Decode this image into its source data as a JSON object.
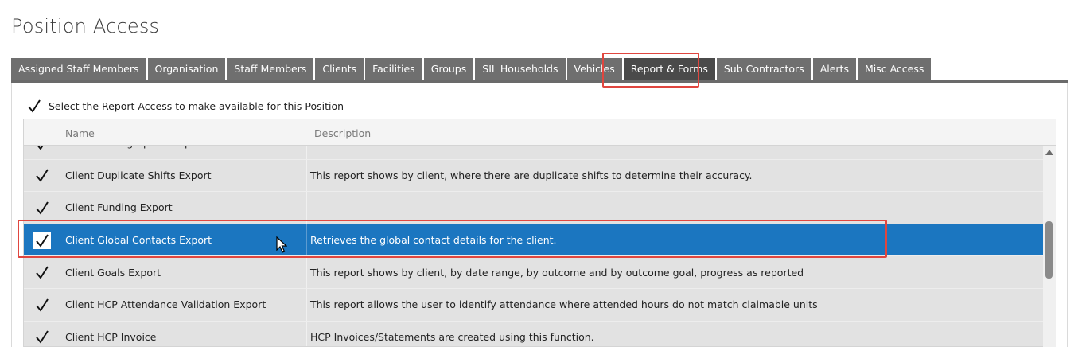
{
  "page": {
    "title": "Position Access"
  },
  "tabs": [
    {
      "label": "Assigned Staff Members",
      "active": false
    },
    {
      "label": "Organisation",
      "active": false
    },
    {
      "label": "Staff Members",
      "active": false
    },
    {
      "label": "Clients",
      "active": false
    },
    {
      "label": "Facilities",
      "active": false
    },
    {
      "label": "Groups",
      "active": false
    },
    {
      "label": "SIL Households",
      "active": false
    },
    {
      "label": "Vehicles",
      "active": false
    },
    {
      "label": "Report & Forms",
      "active": true
    },
    {
      "label": "Sub Contractors",
      "active": false
    },
    {
      "label": "Alerts",
      "active": false
    },
    {
      "label": "Misc Access",
      "active": false
    }
  ],
  "select_all": {
    "label": "Select the Report Access to make available for this Position",
    "checked": true
  },
  "grid": {
    "columns": {
      "name": "Name",
      "description": "Description"
    },
    "rows": [
      {
        "name": "Client Demographics Export",
        "description": "",
        "checked": true,
        "selected": false
      },
      {
        "name": "Client Duplicate Shifts Export",
        "description": "This report shows by client, where there are duplicate shifts to determine their accuracy.",
        "checked": true,
        "selected": false
      },
      {
        "name": "Client Funding Export",
        "description": "",
        "checked": true,
        "selected": false
      },
      {
        "name": "Client Global Contacts Export",
        "description": "Retrieves the global contact details for the client.",
        "checked": true,
        "selected": true
      },
      {
        "name": "Client Goals Export",
        "description": "This report shows by client, by date range, by outcome and by outcome goal, progress as reported",
        "checked": true,
        "selected": false
      },
      {
        "name": "Client HCP Attendance Validation Export",
        "description": "This report allows the user to identify attendance where attended hours do not match claimable units",
        "checked": true,
        "selected": false
      },
      {
        "name": "Client HCP Invoice",
        "description": "HCP Invoices/Statements are created using this function.",
        "checked": true,
        "selected": false
      }
    ]
  },
  "colors": {
    "highlight": "#e0463f",
    "selected_row": "#1b76c0",
    "tab": "#6f6f6f",
    "tab_active": "#4a4a4a"
  }
}
